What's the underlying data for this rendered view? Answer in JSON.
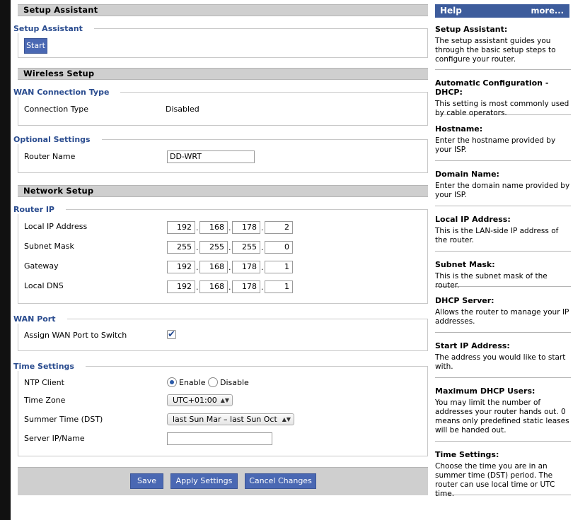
{
  "sections": {
    "setup_assistant": "Setup Assistant",
    "wireless_setup": "Wireless Setup",
    "network_setup": "Network Setup"
  },
  "setup_assistant": {
    "legend": "Setup Assistant",
    "start_label": "Start"
  },
  "wan_connection": {
    "legend": "WAN Connection Type",
    "label": "Connection Type",
    "value": "Disabled"
  },
  "optional_settings": {
    "legend": "Optional Settings",
    "router_name_label": "Router Name",
    "router_name_value": "DD-WRT"
  },
  "router_ip": {
    "legend": "Router IP",
    "rows": [
      {
        "label": "Local IP Address",
        "octets": [
          "192",
          "168",
          "178",
          "2"
        ]
      },
      {
        "label": "Subnet Mask",
        "octets": [
          "255",
          "255",
          "255",
          "0"
        ]
      },
      {
        "label": "Gateway",
        "octets": [
          "192",
          "168",
          "178",
          "1"
        ]
      },
      {
        "label": "Local DNS",
        "octets": [
          "192",
          "168",
          "178",
          "1"
        ]
      }
    ],
    "separator": "."
  },
  "wan_port": {
    "legend": "WAN Port",
    "assign_label": "Assign WAN Port to Switch",
    "assign_checked": true,
    "check_glyph": "✔"
  },
  "time_settings": {
    "legend": "Time Settings",
    "ntp_label": "NTP Client",
    "ntp_enable": "Enable",
    "ntp_disable": "Disable",
    "ntp_selected": "Enable",
    "timezone_label": "Time Zone",
    "timezone_value": "UTC+01:00",
    "dst_label": "Summer Time (DST)",
    "dst_value": "last Sun Mar – last Sun Oct",
    "server_label": "Server IP/Name",
    "server_value": "",
    "select_arrow": "▲▼"
  },
  "footer": {
    "save": "Save",
    "apply": "Apply Settings",
    "cancel": "Cancel Changes"
  },
  "help": {
    "title": "Help",
    "more": "more...",
    "items": [
      {
        "title": "Setup Assistant:",
        "text": "The setup assistant guides you through the basic setup steps to configure your router."
      },
      {
        "title": "Automatic Configuration - DHCP:",
        "text": "This setting is most commonly used by cable operators."
      },
      {
        "title": "Hostname:",
        "text": "Enter the hostname provided by your ISP."
      },
      {
        "title": "Domain Name:",
        "text": "Enter the domain name provided by your ISP."
      },
      {
        "title": "Local IP Address:",
        "text": "This is the LAN-side IP address of the router."
      },
      {
        "title": "Subnet Mask:",
        "text": "This is the subnet mask of the router."
      },
      {
        "title": "DHCP Server:",
        "text": "Allows the router to manage your IP addresses."
      },
      {
        "title": "Start IP Address:",
        "text": "The address you would like to start with."
      },
      {
        "title": "Maximum DHCP Users:",
        "text": "You may limit the number of addresses your router hands out. 0 means only predefined static leases will be handed out."
      },
      {
        "title": "Time Settings:",
        "text": "Choose the time you are in an summer time (DST) period. The router can use local time or UTC time."
      }
    ]
  },
  "colors": {
    "accent": "#4a68b3",
    "legend": "#2a4c8f",
    "help_header": "#3d5c9c",
    "section_bar": "#cfcfcf"
  }
}
